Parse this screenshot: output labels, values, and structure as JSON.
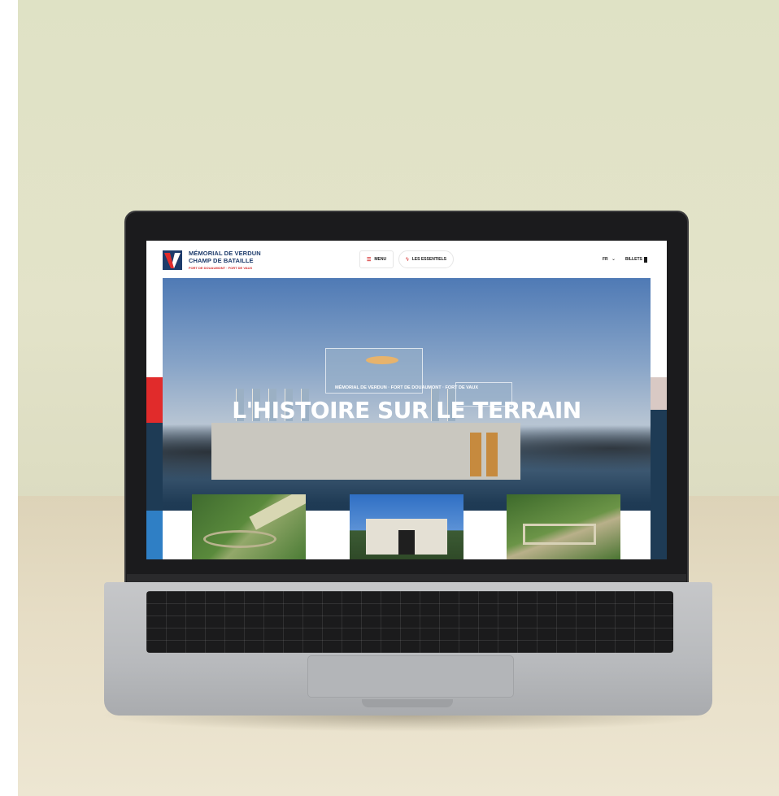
{
  "site": {
    "logo": {
      "line1": "MÉMORIAL DE VERDUN",
      "line2": "CHAMP DE BATAILLE",
      "line3": "FORT DE DOUAUMONT · FORT DE VAUX"
    },
    "nav": {
      "menu_label": "MENU",
      "menu_icon": "hamburger-icon",
      "essentials_label": "LES ESSENTIELS",
      "essentials_icon": "bolt-icon",
      "language": "FR",
      "tickets_label": "BILLETS",
      "tickets_icon": "ticket-icon"
    },
    "hero": {
      "kicker": "MÉMORIAL DE VERDUN · FORT DE DOUAUMONT · FORT DE VAUX",
      "title": "L'HISTOIRE SUR LE TERRAIN"
    },
    "colors": {
      "brand_red": "#e12b2b",
      "brand_navy": "#1d3b6b",
      "brand_blue": "#2f7fc5"
    }
  }
}
